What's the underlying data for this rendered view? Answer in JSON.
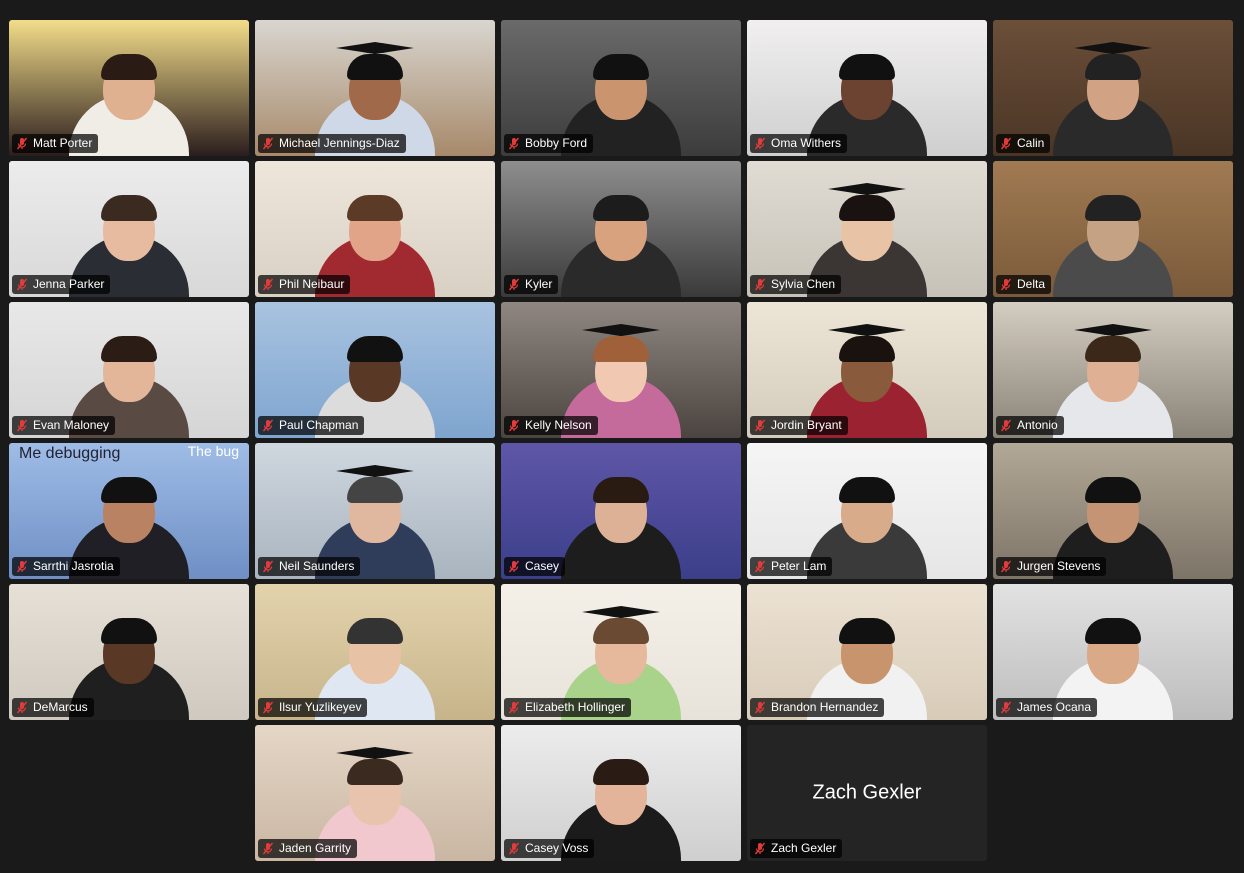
{
  "app": "Zoom meeting gallery view",
  "participants": [
    {
      "name": "Matt Porter",
      "bg": "#2b1d1d",
      "wall": "#f3dd8a",
      "skin": "#e0b191",
      "shirt": "#f0ece6",
      "hair": "#2a1c14",
      "cap": false
    },
    {
      "name": "Michael Jennings-Diaz",
      "bg": "#a7896a",
      "wall": "#d9d6d0",
      "skin": "#a0694a",
      "shirt": "#cfd8e6",
      "hair": "#111",
      "cap": true
    },
    {
      "name": "Bobby Ford",
      "bg": "#3c3c3c",
      "wall": "#6a6a6a",
      "skin": "#c9946e",
      "shirt": "#222",
      "hair": "#111",
      "cap": false
    },
    {
      "name": "Oma Withers",
      "bg": "#cfcfcf",
      "wall": "#f1efef",
      "skin": "#6b4330",
      "shirt": "#2a2a2a",
      "hair": "#111",
      "cap": false
    },
    {
      "name": "Calin",
      "bg": "#4a3525",
      "wall": "#6b4f39",
      "skin": "#d2a284",
      "shirt": "#2a2a2a",
      "hair": "#222",
      "cap": true
    },
    {
      "name": "Jenna Parker",
      "bg": "#d8d8d8",
      "wall": "#ececec",
      "skin": "#e7bba0",
      "shirt": "#2a2d33",
      "hair": "#3a2a20",
      "cap": false
    },
    {
      "name": "Phil Neibaur",
      "bg": "#d9d0c4",
      "wall": "#eee6db",
      "skin": "#e2a489",
      "shirt": "#a02a2f",
      "hair": "#5b3a26",
      "cap": false
    },
    {
      "name": "Kyler",
      "bg": "#3a3a3a",
      "wall": "#8e8e8e",
      "skin": "#d8a27f",
      "shirt": "#2a2a2a",
      "hair": "#1c1c1c",
      "cap": false
    },
    {
      "name": "Sylvia Chen",
      "bg": "#c7c2b8",
      "wall": "#e0dcd3",
      "skin": "#e8c3a5",
      "shirt": "#3b3633",
      "hair": "#1a1210",
      "cap": true
    },
    {
      "name": "Delta",
      "bg": "#7a5a3a",
      "wall": "#a07a52",
      "skin": "#c4a283",
      "shirt": "#4b4b4b",
      "hair": "#222",
      "cap": false
    },
    {
      "name": "Evan Maloney",
      "bg": "#d5d5d5",
      "wall": "#e8e8e8",
      "skin": "#e3b69a",
      "shirt": "#5a4a44",
      "hair": "#2b1d15",
      "cap": false
    },
    {
      "name": "Paul Chapman",
      "bg": "#7ea5cf",
      "wall": "#a9c3e0",
      "skin": "#5a3826",
      "shirt": "#dcdcdc",
      "hair": "#111",
      "cap": false
    },
    {
      "name": "Kelly Nelson",
      "bg": "#4b4440",
      "wall": "#8f8780",
      "skin": "#f1c9b2",
      "shirt": "#c46b9b",
      "hair": "#a0603a",
      "cap": true
    },
    {
      "name": "Jordin Bryant",
      "bg": "#d3cbbb",
      "wall": "#ede6d7",
      "skin": "#8a5a3c",
      "shirt": "#9b2230",
      "hair": "#1a120e",
      "cap": true
    },
    {
      "name": "Antonio",
      "bg": "#8a8378",
      "wall": "#d4cdc2",
      "skin": "#e0b094",
      "shirt": "#e5e7ea",
      "hair": "#3b2818",
      "cap": true
    },
    {
      "name": "Sarrthi Jasrotia",
      "bg": "#6f8fc5",
      "wall": "#9fbce6",
      "skin": "#b98263",
      "shirt": "#1f1f25",
      "hair": "#111",
      "cap": false
    },
    {
      "name": "Neil Saunders",
      "bg": "#a9b4bf",
      "wall": "#cfd7df",
      "skin": "#e0b79f",
      "shirt": "#2f3d5a",
      "hair": "#444",
      "cap": true
    },
    {
      "name": "Casey",
      "bg": "#3b3f8a",
      "wall": "#5f56a8",
      "skin": "#dcb196",
      "shirt": "#1d1d1d",
      "hair": "#2a1b12",
      "cap": false
    },
    {
      "name": "Peter Lam",
      "bg": "#e6e6e6",
      "wall": "#f5f5f5",
      "skin": "#d8ac8a",
      "shirt": "#3a3a3a",
      "hair": "#111",
      "cap": false
    },
    {
      "name": "Jurgen Stevens",
      "bg": "#7d7468",
      "wall": "#b2a896",
      "skin": "#c59474",
      "shirt": "#1e1e1e",
      "hair": "#111",
      "cap": false
    },
    {
      "name": "DeMarcus",
      "bg": "#cfc9bf",
      "wall": "#e6e0d6",
      "skin": "#5a3826",
      "shirt": "#1f1f1f",
      "hair": "#111",
      "cap": false
    },
    {
      "name": "Ilsur Yuzlikeyev",
      "bg": "#c7b48b",
      "wall": "#e3d3ac",
      "skin": "#e8c2a5",
      "shirt": "#dfe8f2",
      "hair": "#333",
      "cap": false
    },
    {
      "name": "Elizabeth Hollinger",
      "bg": "#e8e3da",
      "wall": "#f4f0e8",
      "skin": "#e6b99c",
      "shirt": "#a9d38a",
      "hair": "#6a4a32",
      "cap": true
    },
    {
      "name": "Brandon Hernandez",
      "bg": "#d8cbb8",
      "wall": "#ece2d3",
      "skin": "#c8946d",
      "shirt": "#f1f1f1",
      "hair": "#111",
      "cap": false
    },
    {
      "name": "James Ocana",
      "bg": "#bdbdbd",
      "wall": "#e2e2e2",
      "skin": "#d9a988",
      "shirt": "#f3f3f3",
      "hair": "#111",
      "cap": false
    },
    {
      "blank": true
    },
    {
      "name": "Jaden Garrity",
      "bg": "#c9b7a3",
      "wall": "#e5d6c6",
      "skin": "#e8c3ae",
      "shirt": "#f2c8cf",
      "hair": "#3a2a20",
      "cap": true
    },
    {
      "name": "Casey Voss",
      "bg": "#cfcfcf",
      "wall": "#ececec",
      "skin": "#e3b499",
      "shirt": "#1b1b1b",
      "hair": "#2a1c14",
      "cap": false
    },
    {
      "name": "Zach Gexler",
      "video_off": true,
      "display_name": "Zach Gexler"
    }
  ],
  "memes": {
    "me_debugging": "Me debugging",
    "the_bug": "The bug"
  },
  "colors": {
    "background": "#1a1a1a",
    "active_speaker": "#3ecf5a",
    "mute": "#e23b3b"
  }
}
